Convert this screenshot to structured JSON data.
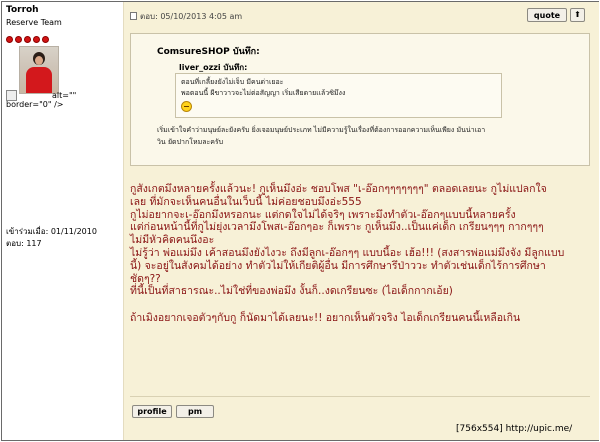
{
  "author": {
    "name": "Torroh",
    "rank": "Reserve Team",
    "rank_dots": 5,
    "broken_image_alt_text": "alt=\"\"",
    "broken_image_border_code": "border=\"0\" />",
    "joined_label": "เข้าร่วมเมื่อ:",
    "joined_value": "01/11/2010",
    "posts_label": "ตอบ:",
    "posts_value": "117"
  },
  "post": {
    "header": "ตอบ: 05/10/2013 4:05 am",
    "quote_button": "quote",
    "top_button_glyph": "⬆"
  },
  "quote": {
    "outer_author": "ComsureSHOP บันทึก:",
    "inner_author": "liver_ozzi บันทึก:",
    "inner_lines": [
      "ตอนที่เกลี้ยงยังไม่เจ็บ มีคนด่าเยอะ",
      "พอตอนนี้ ผีขาวาวจะไม่ต่อสัญญา เริ่มเสียดายเเล้วซิมึงง"
    ],
    "inner_emoticon": "emoticon-icon",
    "outer_lines": [
      "เริ่มเข้าใจคำว่ามนุษย์ละยังครับ ยิ่งเจอมนุษย์ประเภท ไม่มีความรู้ในเรื่องที่ต้องการออกความเห็นเพียง มันน่าเอา",
      "วิน ยัดปากโหมละครับ"
    ]
  },
  "body": {
    "paragraphs": [
      [
        "กูสังเกตมึงหลายครั้งแล้วนะ! กูเห็นมึงอ่ะ ชอบโพส \"เ-อ๊อกๆๆๆๆๆๆๆ\" ตลอดเลยนะ กูไม่แปลกใจ",
        "เลย ที่มักจะเห็นคนอื่นในเว็บนี้ ไม่ค่อยชอบมึงอ่ะ555"
      ],
      [
        "กูไม่อยากจะเ-อ๊อกมึงหรอกนะ แต่กดใจไม่ได้จริๆ เพราะมึงทำตัวเ-อ๊อกๆแบบนี้หลายครั้ง",
        "แต่ก่อนหน้านี้ที่กูไม่ยุ่งเวลามึงโพสเ-อ๊อกๆอะ ก็เพราะ กูเห็นมึง..เป็นแค่เด็ก เกรียนๆๆๆ กากๆๆๆ",
        "ไม่มีหัวคิดคนนึงอะ"
      ],
      [
        "ไม่รู้ว่า พ่อแม่มึง เค้าสอนมึงยังไงวะ ถึงมีลูกเ-อ๊อกๆๆ แบบนี้อะ เฮ้อ!!! (สงสารพ่อแม่มึงจัง มีลูกแบบ",
        "นี้) จะอยู่ในสังคมได้อย่าง ทำตัวไม่ให้เกียติผู้อื่น มีการศึกษารึป่าววะ ทำตัวเช่นเด็กไร้การศึกษา",
        "ชัดๆ??"
      ],
      [
        "ที่นี้เป็นที่สาธารณะ..ไม่ใช่ที่ของพ่อมึง งั้นก็..งดเกรียนซะ (ไอเด็กกากเอ้ย)"
      ],
      [
        "ถ้าเมิงอยากเจอตัวๆกับกู ก็นัดมาได้เลยนะ!! อยากเห็นตัวจริง ไอเด็กเกรียนคนนี้เหลือเกิน"
      ]
    ]
  },
  "actions": {
    "profile_label": "profile",
    "pm_label": "pm"
  },
  "watermark": "[756x554] http://upic.me/",
  "colors": {
    "post_background": "#f7f1d7",
    "body_text": "#8a1414",
    "rank_dot": "#d21414"
  }
}
